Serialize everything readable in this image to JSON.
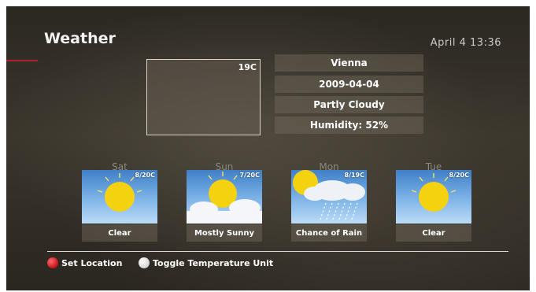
{
  "header": {
    "title": "Weather",
    "datetime": "April 4 13:36"
  },
  "current": {
    "temperature": "19C",
    "location": "Vienna",
    "date": "2009-04-04",
    "condition": "Partly Cloudy",
    "humidity": "Humidity: 52%"
  },
  "forecast": [
    {
      "day": "Sat",
      "temp": "8/20C",
      "condition": "Clear",
      "icon": "sun-icon"
    },
    {
      "day": "Sun",
      "temp": "7/20C",
      "condition": "Mostly Sunny",
      "icon": "sun-cloud-icon"
    },
    {
      "day": "Mon",
      "temp": "8/19C",
      "condition": "Chance of Rain",
      "icon": "sun-rain-cloud-icon"
    },
    {
      "day": "Tue",
      "temp": "8/20C",
      "condition": "Clear",
      "icon": "sun-icon"
    }
  ],
  "legend": {
    "red_label": "Set Location",
    "white_label": "Toggle Temperature Unit"
  },
  "colors": {
    "red_button": "#c4141a",
    "white_button": "#ffffff",
    "sky": "#3f80c8",
    "sun": "#f5d20f"
  }
}
